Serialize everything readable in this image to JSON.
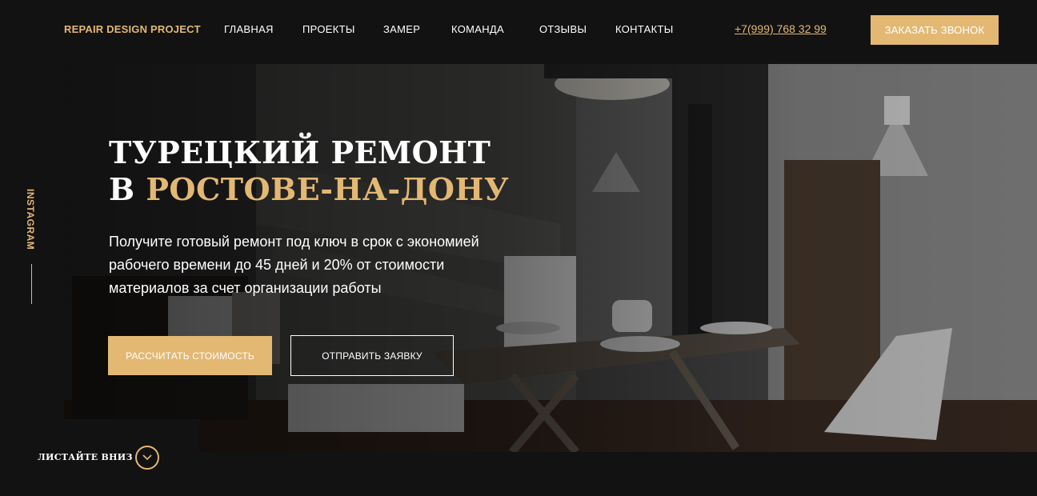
{
  "header": {
    "logo": "REPAIR DESIGN PROJECT",
    "nav": [
      {
        "label": "ГЛАВНАЯ"
      },
      {
        "label": "ПРОЕКТЫ"
      },
      {
        "label": "ЗАМЕР"
      },
      {
        "label": "КОМАНДА"
      },
      {
        "label": "ОТЗЫВЫ"
      },
      {
        "label": "КОНТАКТЫ"
      }
    ],
    "phone": "+7(999) 768 32 99",
    "call_button": "ЗАКАЗАТЬ ЗВОНОК"
  },
  "hero": {
    "title_line1": "ТУРЕЦКИЙ РЕМОНТ",
    "title_line2_prefix": "В ",
    "title_line2_accent": "РОСТОВЕ-НА-ДОНУ",
    "subtitle": "Получите готовый ремонт под ключ в срок с экономией рабочего времени до 45 дней и 20% от стоимости материалов за счет организации работы",
    "primary_button": "РАССЧИТАТЬ СТОИМОСТЬ",
    "secondary_button": "ОТПРАВИТЬ ЗАЯВКУ"
  },
  "side": {
    "instagram": "INSTAGRAM"
  },
  "scroll": {
    "label": "ЛИСТАЙТЕ ВНИЗ"
  },
  "colors": {
    "background": "#121212",
    "accent": "#e3b873",
    "text": "#ffffff"
  },
  "icons": {
    "scroll_down": "chevron-down-icon"
  }
}
